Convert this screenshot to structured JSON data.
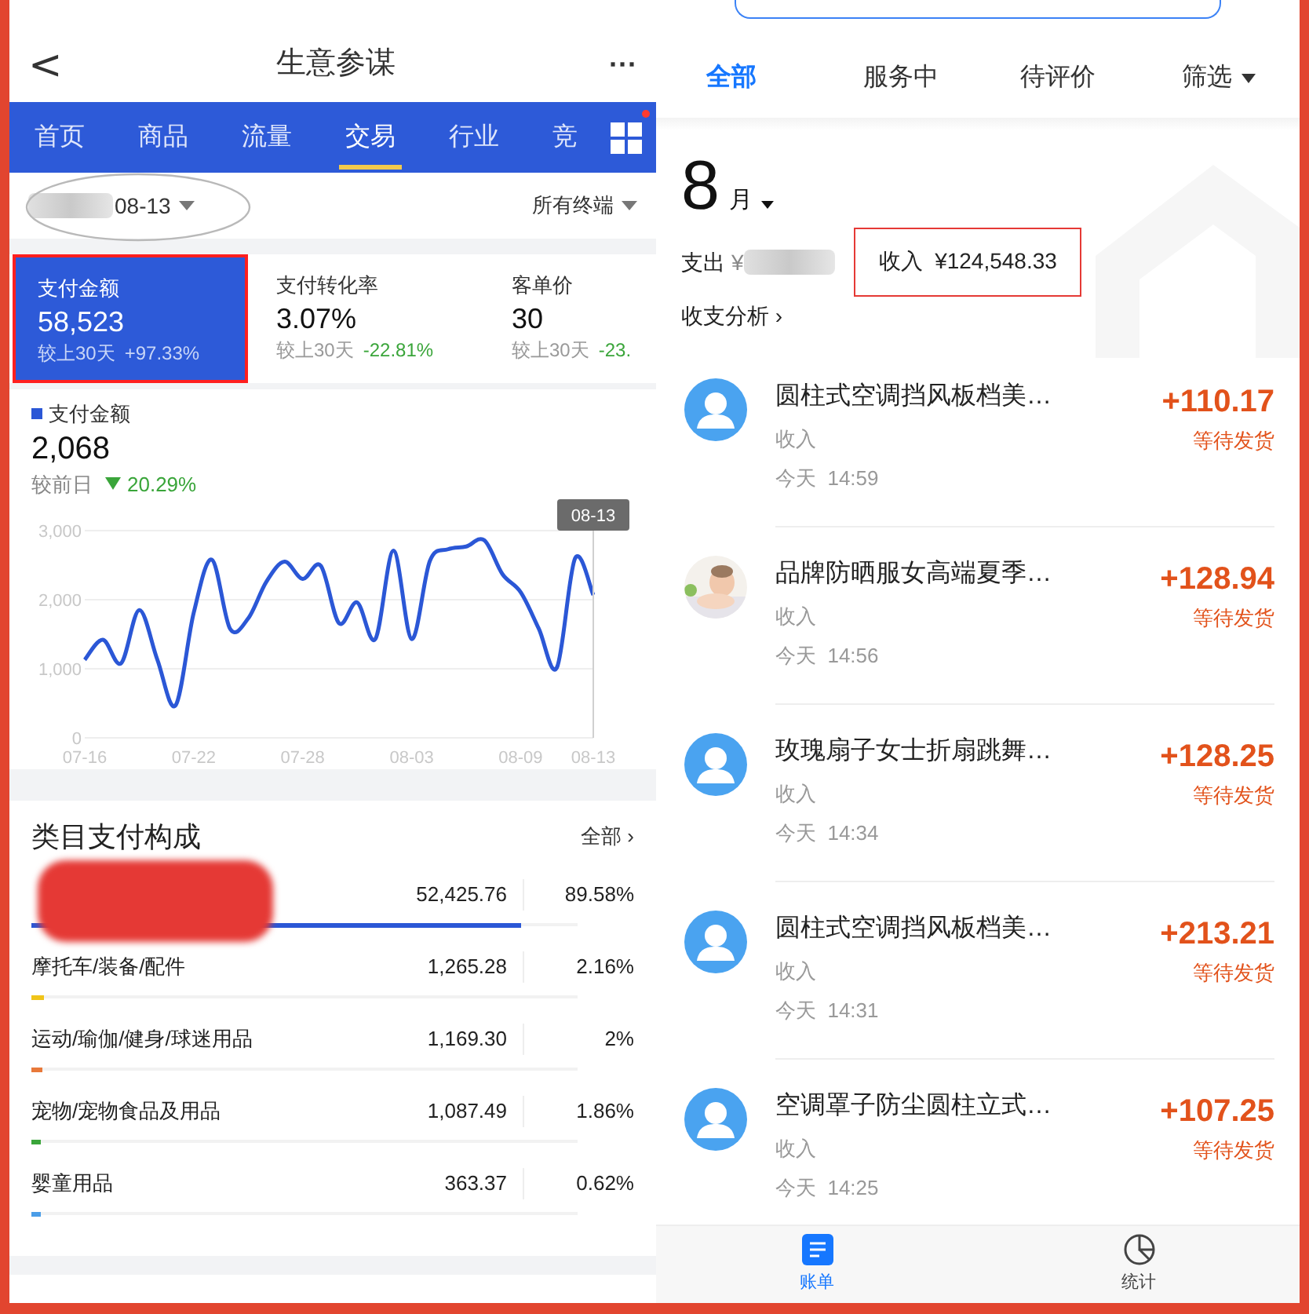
{
  "left": {
    "header": {
      "title": "生意参谋",
      "back": "<",
      "more": "···"
    },
    "tabs": [
      {
        "label": "首页",
        "selected": false
      },
      {
        "label": "商品",
        "selected": false
      },
      {
        "label": "流量",
        "selected": false
      },
      {
        "label": "交易",
        "selected": true
      },
      {
        "label": "行业",
        "selected": false
      },
      {
        "label": "竞",
        "selected": false
      }
    ],
    "grid_badge": true,
    "filter": {
      "date": "08-13",
      "terminal": "所有终端"
    },
    "metrics": [
      {
        "label": "支付金额",
        "value": "58,523",
        "compare": "较上30天",
        "change": "+97.33%",
        "selected": true
      },
      {
        "label": "支付转化率",
        "value": "3.07%",
        "compare": "较上30天",
        "change": "-22.81%",
        "selected": false
      },
      {
        "label": "客单价",
        "value": "30",
        "compare": "较上30天",
        "change": "-23.",
        "selected": false
      }
    ],
    "trend": {
      "value": "2,068",
      "compare": "较前日",
      "change": "20.29%",
      "tooltip": "08-13",
      "chart_data": {
        "type": "line",
        "categories": [
          "07-16",
          null,
          null,
          null,
          null,
          null,
          "07-22",
          null,
          null,
          null,
          null,
          null,
          "07-28",
          null,
          null,
          null,
          null,
          null,
          "08-03",
          null,
          null,
          null,
          null,
          null,
          "08-09",
          null,
          null,
          null,
          "08-13"
        ],
        "series": [
          {
            "name": "支付金额",
            "color": "#2b57d6",
            "values": [
              1130,
              1420,
              1080,
              1850,
              1130,
              470,
              1810,
              2580,
              1580,
              1730,
              2260,
              2550,
              2300,
              2490,
              1660,
              1960,
              1430,
              2710,
              1430,
              2560,
              2730,
              2770,
              2860,
              2370,
              2110,
              1580,
              1020,
              2600,
              2068
            ]
          }
        ],
        "ylim": [
          0,
          3000
        ],
        "yticks": [
          {
            "value": 0,
            "label": "0"
          },
          {
            "value": 1000,
            "label": "1,000"
          },
          {
            "value": 2000,
            "label": "2,000"
          },
          {
            "value": 3000,
            "label": "3,000"
          }
        ]
      }
    },
    "categories": {
      "title": "类目支付构成",
      "all": "全部 ›",
      "rows": [
        {
          "name": "",
          "amount": "52,425.76",
          "share": "89.58%",
          "level": 0.8958,
          "color": "#2b57d6",
          "redacted": true
        },
        {
          "name": "摩托车/装备/配件",
          "amount": "1,265.28",
          "share": "2.16%",
          "level": 0.0216,
          "color": "#f0c419",
          "redacted": false
        },
        {
          "name": "运动/瑜伽/健身/球迷用品",
          "amount": "1,169.30",
          "share": "2%",
          "level": 0.02,
          "color": "#e8793a",
          "redacted": false
        },
        {
          "name": "宠物/宠物食品及用品",
          "amount": "1,087.49",
          "share": "1.86%",
          "level": 0.0186,
          "color": "#3aa53a",
          "redacted": false
        },
        {
          "name": "婴童用品",
          "amount": "363.37",
          "share": "0.62%",
          "level": 0.0062,
          "color": "#4a9de8",
          "redacted": false
        }
      ]
    }
  },
  "right": {
    "tabs": [
      {
        "label": "全部",
        "selected": true
      },
      {
        "label": "服务中",
        "selected": false
      },
      {
        "label": "待评价",
        "selected": false
      }
    ],
    "filter": "筛选",
    "summary": {
      "month": "8",
      "month_unit": "月",
      "expense_label": "支出",
      "expense_prefix": "¥",
      "income": "收入  ¥124,548.33",
      "analysis": "收支分析 ›"
    },
    "transactions": [
      {
        "title": "圆柱式空调挡风板档美…",
        "type": "收入",
        "time": "今天  14:59",
        "amount": "+110.17",
        "status": "等待发货",
        "kind": "default"
      },
      {
        "title": "品牌防晒服女高端夏季…",
        "type": "收入",
        "time": "今天  14:56",
        "amount": "+128.94",
        "status": "等待发货",
        "kind": "picture"
      },
      {
        "title": "玫瑰扇子女士折扇跳舞…",
        "type": "收入",
        "time": "今天  14:34",
        "amount": "+128.25",
        "status": "等待发货",
        "kind": "default"
      },
      {
        "title": "圆柱式空调挡风板档美…",
        "type": "收入",
        "time": "今天  14:31",
        "amount": "+213.21",
        "status": "等待发货",
        "kind": "default"
      },
      {
        "title": "空调罩子防尘圆柱立式…",
        "type": "收入",
        "time": "今天  14:25",
        "amount": "+107.25",
        "status": "等待发货",
        "kind": "default"
      }
    ],
    "nav": [
      {
        "label": "账单",
        "selected": true,
        "kind": "bill"
      },
      {
        "label": "统计",
        "selected": false,
        "kind": "stats"
      }
    ]
  }
}
